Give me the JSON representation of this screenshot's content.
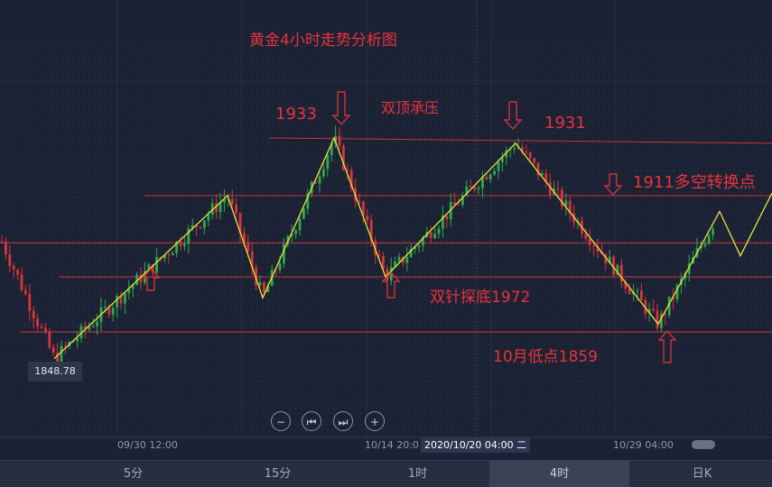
{
  "chart_data": {
    "type": "candlestick",
    "title": "黄金4小时走势分析图",
    "y_unit": "price",
    "levels": [
      1933,
      1931,
      1911,
      1872,
      1859
    ],
    "annotations": {
      "double_top_label": "双顶承压",
      "level_1933": "1933",
      "level_1931": "1931",
      "level_1911": "1911多空转换点",
      "double_bottom": "双针探底1972",
      "october_low": "10月低点1859"
    },
    "low_label": "1848.78",
    "x_labels": [
      "09/30 12:00",
      "10/14 20:0",
      "10/29 04:00"
    ],
    "crosshair_label": "2020/10/20 04:00 二",
    "zigzag": [
      1848.78,
      1911,
      1872,
      1933,
      1880,
      1931,
      1862,
      1905,
      1888,
      1912
    ],
    "colors": {
      "up": "#2fa84f",
      "down": "#d9343b",
      "zigzag": "#e8e23a",
      "level": "#d0313a",
      "background": "#1b2234"
    }
  },
  "controls": [
    "−",
    "⏮",
    "⏭",
    "+"
  ],
  "timeframes": [
    "5分",
    "15分",
    "1时",
    "4时",
    "日K"
  ],
  "active_timeframe": "4时"
}
